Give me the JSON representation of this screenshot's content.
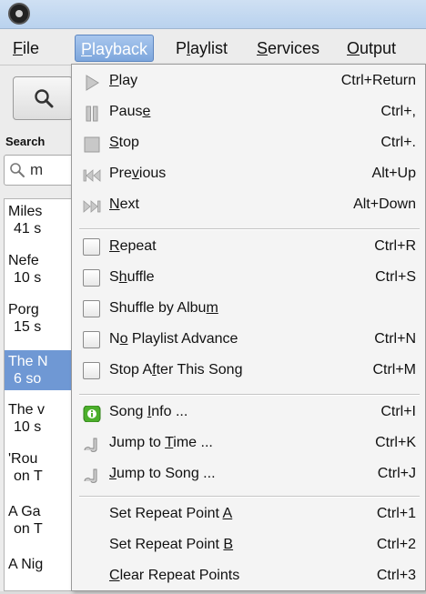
{
  "menubar": {
    "items": [
      {
        "pre": "",
        "u": "F",
        "post": "ile"
      },
      {
        "pre": "",
        "u": "P",
        "post": "layback"
      },
      {
        "pre": "P",
        "u": "l",
        "post": "aylist"
      },
      {
        "pre": "",
        "u": "S",
        "post": "ervices"
      },
      {
        "pre": "",
        "u": "O",
        "post": "utput"
      }
    ]
  },
  "left_panel": {
    "search_label": "Search",
    "search_value": "m",
    "results": [
      {
        "title": "Miles",
        "sub": "41 s"
      },
      {
        "title": "Nefe",
        "sub": "10 s"
      },
      {
        "title": "Porg",
        "sub": "15 s"
      },
      {
        "title": "The N",
        "sub": "6 so"
      },
      {
        "title": "The v",
        "sub": "10 s"
      },
      {
        "title": "'Rou",
        "sub": "on T"
      },
      {
        "title": "A Ga",
        "sub": "on T"
      },
      {
        "title": "A Nig",
        "sub": ""
      }
    ]
  },
  "playback_menu": {
    "items": [
      {
        "pre": "",
        "u": "P",
        "post": "lay",
        "shortcut": "Ctrl+Return"
      },
      {
        "pre": "Paus",
        "u": "e",
        "post": "",
        "shortcut": "Ctrl+,"
      },
      {
        "pre": "",
        "u": "S",
        "post": "top",
        "shortcut": "Ctrl+."
      },
      {
        "pre": "Pre",
        "u": "v",
        "post": "ious",
        "shortcut": "Alt+Up"
      },
      {
        "pre": "",
        "u": "N",
        "post": "ext",
        "shortcut": "Alt+Down"
      },
      {
        "pre": "",
        "u": "R",
        "post": "epeat",
        "shortcut": "Ctrl+R"
      },
      {
        "pre": "S",
        "u": "h",
        "post": "uffle",
        "shortcut": "Ctrl+S"
      },
      {
        "pre": "Shuffle by Albu",
        "u": "m",
        "post": "",
        "shortcut": ""
      },
      {
        "pre": "N",
        "u": "o",
        "post": " Playlist Advance",
        "shortcut": "Ctrl+N"
      },
      {
        "pre": "Stop A",
        "u": "f",
        "post": "ter This Song",
        "shortcut": "Ctrl+M"
      },
      {
        "pre": "Song ",
        "u": "I",
        "post": "nfo ...",
        "shortcut": "Ctrl+I"
      },
      {
        "pre": "Jump to ",
        "u": "T",
        "post": "ime ...",
        "shortcut": "Ctrl+K"
      },
      {
        "pre": "",
        "u": "J",
        "post": "ump to Song ...",
        "shortcut": "Ctrl+J"
      },
      {
        "pre": "Set Repeat Point ",
        "u": "A",
        "post": "",
        "shortcut": "Ctrl+1"
      },
      {
        "pre": "Set Repeat Point ",
        "u": "B",
        "post": "",
        "shortcut": "Ctrl+2"
      },
      {
        "pre": "",
        "u": "C",
        "post": "lear Repeat Points",
        "shortcut": "Ctrl+3"
      }
    ]
  },
  "colors": {
    "menu_highlight": "#7da6dc",
    "selected_row": "#6f98d4",
    "info_icon": "#4caf2c"
  }
}
